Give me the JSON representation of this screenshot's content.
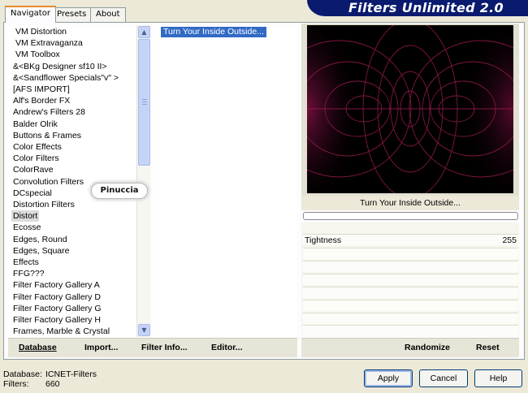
{
  "app_title": "Filters Unlimited 2.0",
  "tabs": [
    {
      "label": "Navigator"
    },
    {
      "label": "Presets"
    },
    {
      "label": "About"
    }
  ],
  "categories": [
    {
      "label": "VM Distortion"
    },
    {
      "label": "VM Extravaganza"
    },
    {
      "label": "VM Toolbox"
    },
    {
      "label": "&<BKg Designer sf10 II>"
    },
    {
      "label": "&<Sandflower Specials\"v\" >"
    },
    {
      "label": "[AFS IMPORT]"
    },
    {
      "label": "Alf's Border FX"
    },
    {
      "label": "Andrew's Filters 28"
    },
    {
      "label": "Balder Olrik"
    },
    {
      "label": "Buttons & Frames"
    },
    {
      "label": "Color Effects"
    },
    {
      "label": "Color Filters"
    },
    {
      "label": "ColorRave"
    },
    {
      "label": "Convolution Filters"
    },
    {
      "label": "DCspecial"
    },
    {
      "label": "Distortion Filters"
    },
    {
      "label": "Distort"
    },
    {
      "label": "Ecosse"
    },
    {
      "label": "Edges, Round"
    },
    {
      "label": "Edges, Square"
    },
    {
      "label": "Effects"
    },
    {
      "label": "FFG???"
    },
    {
      "label": "Filter Factory Gallery A"
    },
    {
      "label": "Filter Factory Gallery D"
    },
    {
      "label": "Filter Factory Gallery G"
    },
    {
      "label": "Filter Factory Gallery H"
    },
    {
      "label": "Frames, Marble & Crystal"
    }
  ],
  "selected_category": "Distort",
  "effects": [
    {
      "label": "Turn Your Inside Outside..."
    }
  ],
  "watermark": "Pinuccia",
  "list_buttons": {
    "database": "Database",
    "import": "Import...",
    "filter_info": "Filter Info...",
    "editor": "Editor..."
  },
  "preview": {
    "caption": "Turn Your Inside Outside...",
    "progress": 0
  },
  "parameters": [
    {
      "name": "Tightness",
      "value": "255"
    }
  ],
  "param_buttons": {
    "randomize": "Randomize",
    "reset": "Reset"
  },
  "footer": {
    "database_label": "Database:",
    "database_value": "ICNET-Filters",
    "filters_label": "Filters:",
    "filters_value": "660"
  },
  "dialog_buttons": {
    "apply": "Apply",
    "cancel": "Cancel",
    "help": "Help"
  },
  "colors": {
    "banner": "#0a1a6e",
    "selection": "#316ac5",
    "preview_bg": "#000000",
    "preview_lines": "#8a1848"
  },
  "icons": {
    "scroll_up": "chevron-up-icon",
    "scroll_down": "chevron-down-icon"
  }
}
